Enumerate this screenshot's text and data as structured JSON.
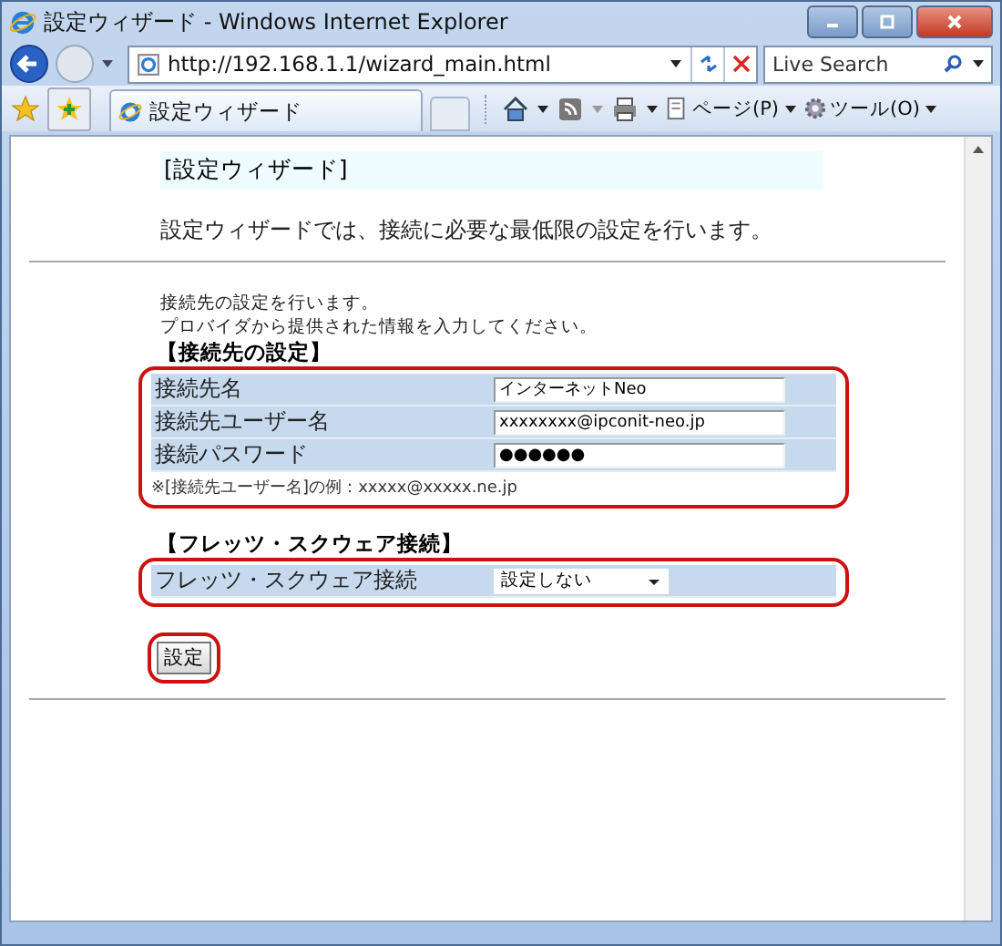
{
  "window": {
    "title": "設定ウィザード - Windows Internet Explorer"
  },
  "address_bar": {
    "url": "http://192.168.1.1/wizard_main.html"
  },
  "search": {
    "placeholder": "Live Search"
  },
  "tab": {
    "label": "設定ウィザード",
    "selected": true
  },
  "toolbar": {
    "page_menu": "ページ(P)",
    "tools_menu": "ツール(O)"
  },
  "page": {
    "heading": "[設定ウィザード]",
    "description": "設定ウィザードでは、接続に必要な最低限の設定を行います。",
    "intro": [
      "接続先の設定を行います。",
      "プロバイダから提供された情報を入力してください。"
    ],
    "sections": [
      {
        "title": "【接続先の設定】",
        "rows": [
          {
            "kind": "text",
            "label": "接続先名",
            "value": "インターネットNeo"
          },
          {
            "kind": "text",
            "label": "接続先ユーザー名",
            "value": "xxxxxxxx@ipconit-neo.jp"
          },
          {
            "kind": "text",
            "label": "接続パスワード",
            "value": "●●●●●●"
          }
        ],
        "note": "※[接続先ユーザー名]の例：xxxxx@xxxxx.ne.jp"
      },
      {
        "title": "【フレッツ・スクウェア接続】",
        "rows": [
          {
            "kind": "select",
            "label": "フレッツ・スクウェア接続",
            "value": "設定しない"
          }
        ]
      }
    ],
    "submit": "設定"
  }
}
